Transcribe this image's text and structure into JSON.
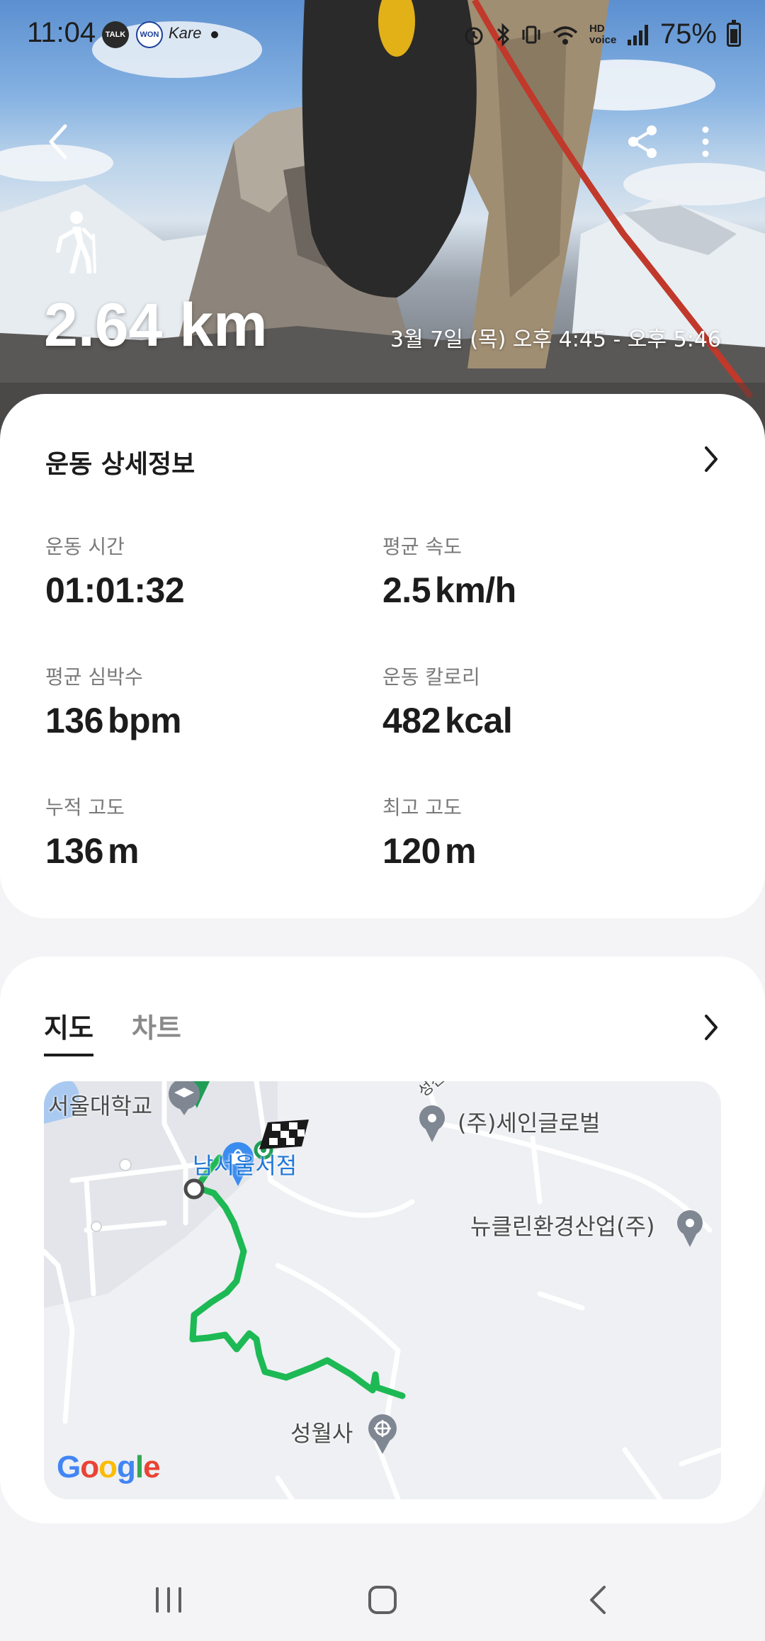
{
  "status_bar": {
    "time": "11:04",
    "apps": [
      "TALK",
      "WON",
      "Kare"
    ],
    "battery": "75%",
    "network": "HD voice"
  },
  "hero": {
    "activity_icon": "hiking-icon",
    "distance": "2.64 km",
    "datetime": "3월 7일 (목) 오후 4:45 - 오후 5:46"
  },
  "details": {
    "title": "운동 상세정보",
    "stats": [
      {
        "label": "운동 시간",
        "value": "01:01:32",
        "unit": ""
      },
      {
        "label": "평균 속도",
        "value": "2.5",
        "unit": "km/h"
      },
      {
        "label": "평균 심박수",
        "value": "136",
        "unit": "bpm"
      },
      {
        "label": "운동 칼로리",
        "value": "482",
        "unit": "kcal"
      },
      {
        "label": "누적 고도",
        "value": "136",
        "unit": "m"
      },
      {
        "label": "최고 고도",
        "value": "120",
        "unit": "m"
      }
    ]
  },
  "map_card": {
    "tabs": [
      "지도",
      "차트"
    ],
    "active_tab": "지도",
    "places": {
      "university": "서울대학교",
      "bookstore": "남서울서점",
      "street": "성진로",
      "company1": "(주)세인글로벌",
      "company2": "뉴클린환경산업(주)",
      "temple": "성월사"
    },
    "logo": "Google",
    "route_color": "#1db954"
  },
  "colors": {
    "accent": "#1db954",
    "card_bg": "#ffffff",
    "page_bg": "#f4f4f6"
  }
}
